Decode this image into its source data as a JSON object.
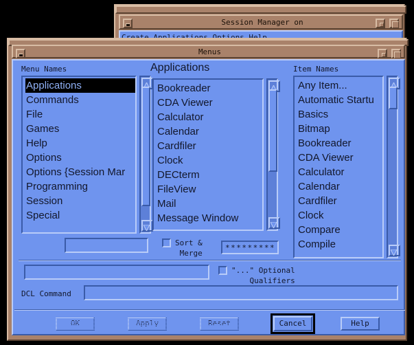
{
  "background_window": {
    "title": "Session Manager on",
    "menubar_clipped": "Create     Applications     Options                         Help",
    "minimize_icon": "minimize-icon",
    "restore_icon": "restore-icon",
    "maximize_icon": "maximize-icon"
  },
  "window": {
    "title": "Menus",
    "minimize_icon": "minimize-icon",
    "restore_icon": "restore-icon",
    "maximize_icon": "maximize-icon"
  },
  "menu_names": {
    "label": "Menu Names",
    "selected_index": 0,
    "items": [
      "Applications",
      "Commands",
      "File",
      "Games",
      "Help",
      "Options",
      "Options {Session Mar",
      "Programming",
      "Session",
      "Special"
    ],
    "scrollbar": {
      "up_icon": "scroll-up-arrow-icon",
      "down_icon": "scroll-down-arrow-icon",
      "thumb_top_pct": 0,
      "thumb_height_pct": 86
    }
  },
  "applications": {
    "title": "Applications",
    "items": [
      "Bookreader",
      "CDA Viewer",
      "Calculator",
      "Calendar",
      "Cardfiler",
      "Clock",
      "DECterm",
      "FileView",
      "Mail",
      "Message Window"
    ],
    "scrollbar": {
      "up_icon": "scroll-up-arrow-icon",
      "down_icon": "scroll-down-arrow-icon",
      "thumb_top_pct": 0,
      "thumb_height_pct": 62
    }
  },
  "item_names": {
    "label": "Item Names",
    "items": [
      "Any Item...",
      "Automatic Startu",
      "Basics",
      "Bitmap",
      "Bookreader",
      "CDA Viewer",
      "Calculator",
      "Calendar",
      "Cardfiler",
      "Clock",
      "Compare",
      "Compile"
    ],
    "scrollbar": {
      "up_icon": "scroll-up-arrow-icon",
      "down_icon": "scroll-down-arrow-icon",
      "thumb_top_pct": 0,
      "thumb_height_pct": 14
    }
  },
  "controls": {
    "name_field_value": "",
    "sort_merge": {
      "label": "Sort &\nMerge",
      "checked": false,
      "checkbox_icon": "checkbox-unchecked-icon"
    },
    "pattern_field_value": "**********",
    "command_field_value": "",
    "optional_qualifiers": {
      "label": "\"...\" Optional\n Qualifiers",
      "checked": false,
      "checkbox_icon": "checkbox-unchecked-icon"
    },
    "dcl_command": {
      "label": "DCL Command",
      "value": ""
    }
  },
  "buttons": {
    "ok": {
      "label": "OK",
      "enabled": false
    },
    "apply": {
      "label": "Apply",
      "enabled": false
    },
    "reset": {
      "label": "Reset",
      "enabled": false
    },
    "cancel": {
      "label": "Cancel",
      "enabled": true,
      "is_default": true
    },
    "help": {
      "label": "Help",
      "enabled": true
    }
  },
  "colors": {
    "frame": "#a9826a",
    "client": "#6f94ee",
    "text": "#12172b",
    "selection_bg": "#000000",
    "selection_fg": "#8fb0f5",
    "scroll_trough": "#5d80d8",
    "desktop": "#000000"
  }
}
